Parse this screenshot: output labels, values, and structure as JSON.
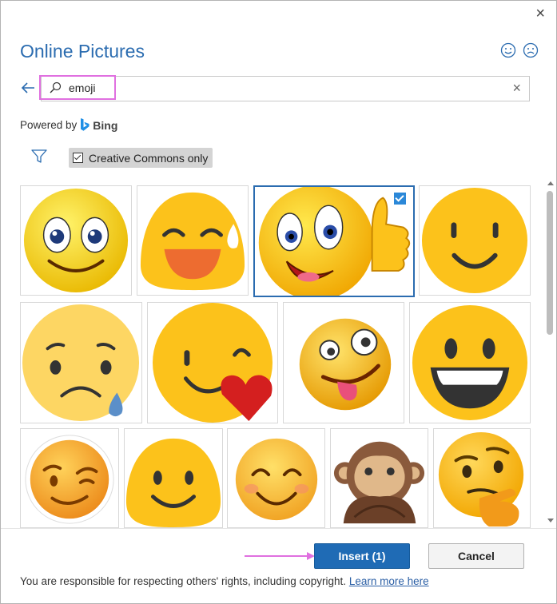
{
  "dialog": {
    "title": "Online Pictures",
    "close_label": "×"
  },
  "search": {
    "value": "emoji",
    "clear_label": "×"
  },
  "powered_by": {
    "prefix": "Powered by",
    "brand": "Bing"
  },
  "filter": {
    "creative_commons_label": "Creative Commons only",
    "creative_commons_checked": true
  },
  "images": [
    {
      "name": "yellow-smiley-blue-eyes"
    },
    {
      "name": "laughing-sweat-blob"
    },
    {
      "name": "thumbs-up-emoji",
      "selected": true
    },
    {
      "name": "simple-smiley"
    },
    {
      "name": "sad-tear-emoji"
    },
    {
      "name": "wink-heart-emoji"
    },
    {
      "name": "zany-face-emoji"
    },
    {
      "name": "grinning-face-emoji"
    },
    {
      "name": "winking-face-emoji"
    },
    {
      "name": "smiling-blob-emoji"
    },
    {
      "name": "smiling-eyes-emoji"
    },
    {
      "name": "speak-no-evil-monkey-emoji"
    },
    {
      "name": "thinking-face-emoji"
    }
  ],
  "buttons": {
    "insert_label": "Insert (1)",
    "cancel_label": "Cancel"
  },
  "footer": {
    "text": "You are responsible for respecting others' rights, including copyright.",
    "link": "Learn more here"
  },
  "colors": {
    "accent": "#2b6cb0",
    "insert_button": "#1f6bb5",
    "annotation": "#e070e0",
    "emoji_yellow": "#fcc21b"
  }
}
